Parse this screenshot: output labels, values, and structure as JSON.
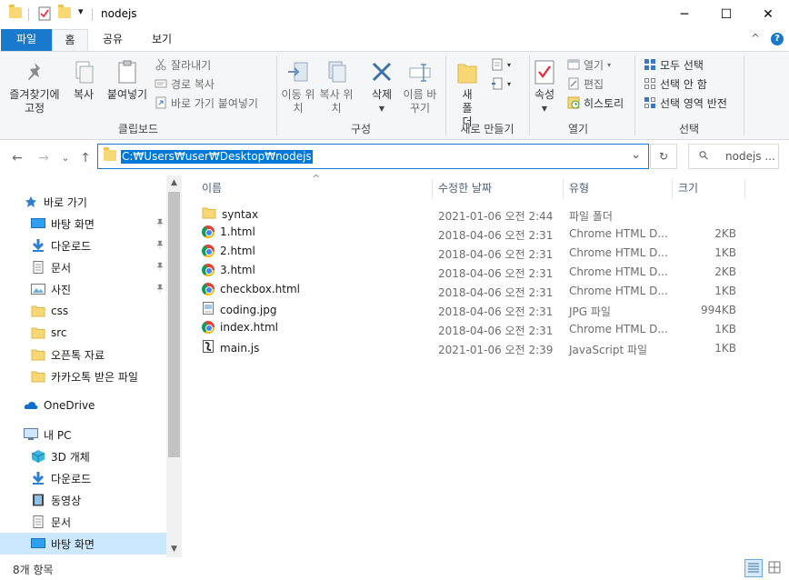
{
  "window": {
    "title": "nodejs",
    "minimize_label": "─",
    "maximize_label": "☐",
    "close_label": "✕",
    "qat_dropdown": "▾"
  },
  "ribbon_tabs": [
    "파일",
    "홈",
    "공유",
    "보기"
  ],
  "ribbon_extra": {
    "collapse": "^",
    "help": "?"
  },
  "ribbon": {
    "clipboard": {
      "label": "클립보드",
      "pin": "즐겨찾기에 고정",
      "copy": "복사",
      "paste": "붙여넣기",
      "cut": "잘라내기",
      "copy_path": "경로 복사",
      "paste_shortcut": "바로 가기 붙여넣기"
    },
    "organize": {
      "label": "구성",
      "move_to": "이동 위치",
      "copy_to": "복사 위치",
      "delete": "삭제",
      "rename": "이름 바꾸기"
    },
    "new": {
      "label": "새로 만들기",
      "new_folder": "새 폴더"
    },
    "open": {
      "label": "열기",
      "properties": "속성",
      "open": "열기",
      "edit": "편집",
      "history": "히스토리"
    },
    "select": {
      "label": "선택",
      "select_all": "모두 선택",
      "select_none": "선택 안 함",
      "invert": "선택 영역 반전"
    }
  },
  "address": {
    "path": "C:₩Users₩user₩Desktop₩nodejs",
    "search_placeholder": "nodejs ...",
    "back": "←",
    "forward": "→",
    "recent": "⌄",
    "up": "↑",
    "dropdown": "⌄",
    "refresh": "↻",
    "search_icon": "⚲"
  },
  "nav_pane": {
    "quick_access": "바로 가기",
    "quick_items": [
      {
        "label": "바탕 화면",
        "icon": "desktop-icon",
        "pinned": true
      },
      {
        "label": "다운로드",
        "icon": "download-icon",
        "pinned": true
      },
      {
        "label": "문서",
        "icon": "document-icon",
        "pinned": true
      },
      {
        "label": "사진",
        "icon": "picture-icon",
        "pinned": true
      },
      {
        "label": "css",
        "icon": "folder-icon",
        "pinned": false
      },
      {
        "label": "src",
        "icon": "folder-icon",
        "pinned": false
      },
      {
        "label": "오픈톡 자료",
        "icon": "folder-icon",
        "pinned": false
      },
      {
        "label": "카카오톡 받은 파일",
        "icon": "folder-icon",
        "pinned": false
      }
    ],
    "onedrive": "OneDrive",
    "this_pc": "내 PC",
    "pc_items": [
      {
        "label": "3D 개체",
        "icon": "3d-objects-icon"
      },
      {
        "label": "다운로드",
        "icon": "download-icon"
      },
      {
        "label": "동영상",
        "icon": "video-icon"
      },
      {
        "label": "문서",
        "icon": "document-icon"
      },
      {
        "label": "바탕 화면",
        "icon": "desktop-icon",
        "selected": true
      }
    ],
    "pin_glyph": "📌"
  },
  "file_list": {
    "sort_indicator": "^",
    "columns": {
      "name": "이름",
      "date": "수정한 날짜",
      "type": "유형",
      "size": "크기"
    },
    "rows": [
      {
        "name": "syntax",
        "date": "2021-01-06 오전 2:44",
        "type": "파일 폴더",
        "size": "",
        "icon": "folder-icon"
      },
      {
        "name": "1.html",
        "date": "2018-04-06 오전 2:31",
        "type": "Chrome HTML D...",
        "size": "2KB",
        "icon": "chrome-icon"
      },
      {
        "name": "2.html",
        "date": "2018-04-06 오전 2:31",
        "type": "Chrome HTML D...",
        "size": "1KB",
        "icon": "chrome-icon"
      },
      {
        "name": "3.html",
        "date": "2018-04-06 오전 2:31",
        "type": "Chrome HTML D...",
        "size": "2KB",
        "icon": "chrome-icon"
      },
      {
        "name": "checkbox.html",
        "date": "2018-04-06 오전 2:31",
        "type": "Chrome HTML D...",
        "size": "1KB",
        "icon": "chrome-icon"
      },
      {
        "name": "coding.jpg",
        "date": "2018-04-06 오전 2:31",
        "type": "JPG 파일",
        "size": "994KB",
        "icon": "image-file-icon"
      },
      {
        "name": "index.html",
        "date": "2018-04-06 오전 2:31",
        "type": "Chrome HTML D...",
        "size": "1KB",
        "icon": "chrome-icon"
      },
      {
        "name": "main.js",
        "date": "2021-01-06 오전 2:39",
        "type": "JavaScript 파일",
        "size": "1KB",
        "icon": "js-file-icon"
      }
    ]
  },
  "status_bar": {
    "item_count": "8개 항목"
  },
  "colors": {
    "accent": "#1979ca",
    "selection": "#0078d7",
    "nav_selected": "#cce8ff",
    "folder": "#f8d775"
  }
}
